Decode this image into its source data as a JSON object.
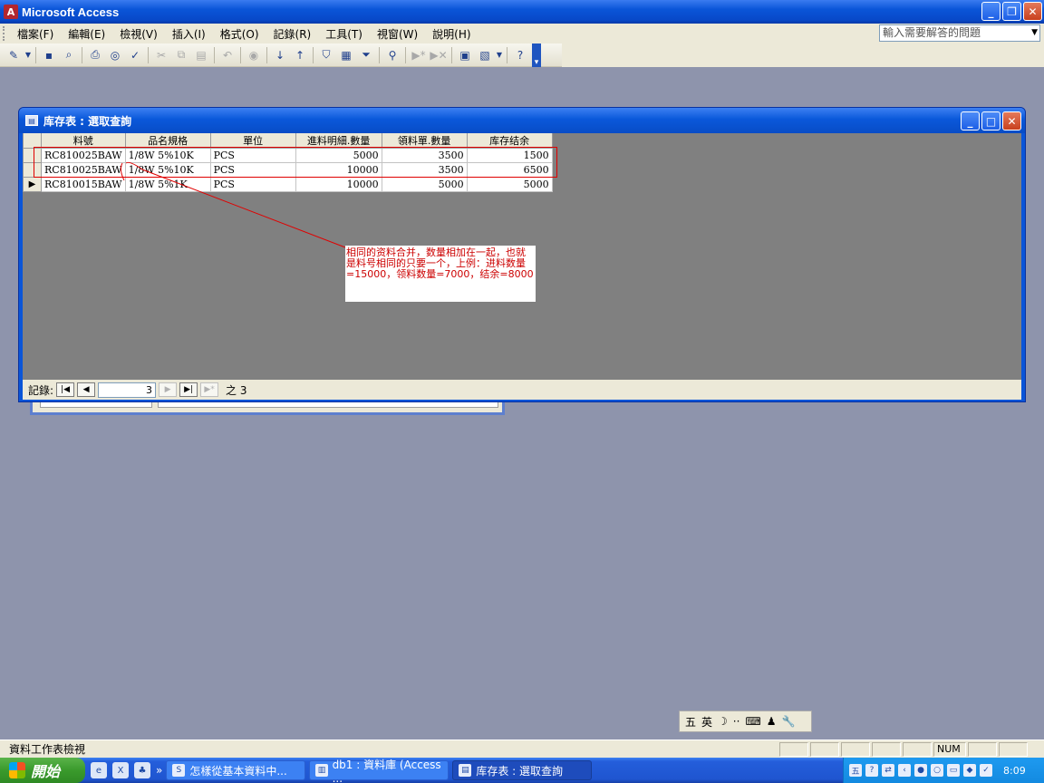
{
  "app": {
    "title": "Microsoft Access",
    "window_controls": [
      "minimize-icon",
      "restore-icon",
      "close-icon"
    ]
  },
  "menu": {
    "items": [
      "檔案(F)",
      "編輯(E)",
      "檢視(V)",
      "插入(I)",
      "格式(O)",
      "記錄(R)",
      "工具(T)",
      "視窗(W)",
      "說明(H)"
    ],
    "help_placeholder": "輸入需要解答的問題"
  },
  "query_window": {
    "title": "库存表 : 選取查詢",
    "columns": [
      "料號",
      "品名規格",
      "單位",
      "進料明細.數量",
      "領料單.數量",
      "库存结余"
    ],
    "rows": [
      [
        "RC810025BAW",
        "1/8W 5%10K",
        "PCS",
        "5000",
        "3500",
        "1500"
      ],
      [
        "RC810025BAW",
        "1/8W 5%10K",
        "PCS",
        "10000",
        "3500",
        "6500"
      ],
      [
        "RC810015BAW",
        "1/8W 5%1K",
        "PCS",
        "10000",
        "5000",
        "5000"
      ]
    ],
    "annotation": "相同的资料合并，数量相加在一起，也就是料号相同的只要一个，上例：进料数量=15000，领料数量=7000，结余=8000",
    "record_nav": {
      "label": "記錄:",
      "current": "3",
      "of_label": "之 3"
    }
  },
  "ime": {
    "items": [
      "五",
      "英",
      "☽",
      "··",
      "⌨",
      "♟",
      "🔧"
    ]
  },
  "status": {
    "text": "資料工作表檢視",
    "num": "NUM"
  },
  "taskbar": {
    "start": "開始",
    "tasks": [
      "怎樣從基本資料中...",
      "db1 : 資料庫 (Access ...",
      "库存表 : 選取查詢"
    ],
    "clock": "8:09"
  },
  "colors": {
    "titlebar": "#0a55d8",
    "annotation_text": "#cc0000",
    "highlight_box": "#e00000"
  }
}
